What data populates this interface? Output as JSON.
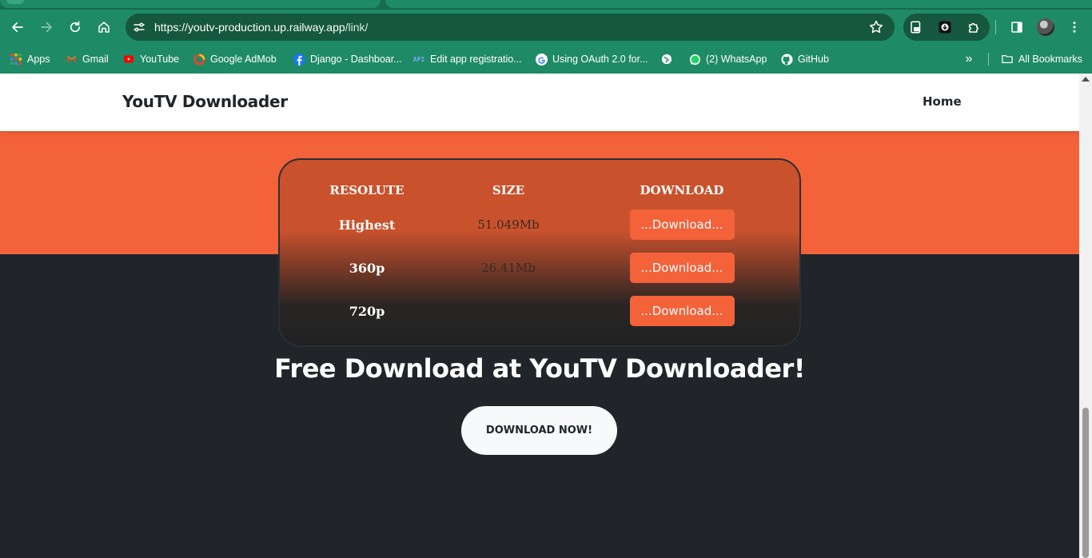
{
  "browser": {
    "url_host": "https://youtv-production.up.railway.app",
    "url_path": "/link/",
    "bookmarks": [
      {
        "label": "Apps",
        "icon": "apps-grid-icon"
      },
      {
        "label": "Gmail",
        "icon": "gmail-icon"
      },
      {
        "label": "YouTube",
        "icon": "youtube-icon"
      },
      {
        "label": "Google AdMob",
        "icon": "admob-icon"
      },
      {
        "label": "Django - Dashboar...",
        "icon": "facebook-icon"
      },
      {
        "label": "Edit app registratio...",
        "icon": "api-icon"
      },
      {
        "label": "Using OAuth 2.0 for...",
        "icon": "google-icon"
      },
      {
        "label": "",
        "icon": "globe-icon"
      },
      {
        "label": "(2) WhatsApp",
        "icon": "whatsapp-icon"
      },
      {
        "label": "GitHub",
        "icon": "github-icon"
      }
    ],
    "all_bookmarks_label": "All Bookmarks"
  },
  "site": {
    "brand": "YouTV Downloader",
    "nav_home": "Home"
  },
  "table": {
    "headers": [
      "RESOLUTE",
      "SIZE",
      "DOWNLOAD"
    ],
    "rows": [
      {
        "resolution": "Highest",
        "size": "51.049Mb",
        "button": "...Download..."
      },
      {
        "resolution": "360p",
        "size": "26.41Mb",
        "button": "...Download..."
      },
      {
        "resolution": "720p",
        "size": "",
        "button": "...Download..."
      }
    ]
  },
  "cta": {
    "title": "Free Download at YouTV Downloader!",
    "button": "DOWNLOAD NOW!"
  },
  "colors": {
    "browser_green": "#1f8a66",
    "accent_orange": "#f4623a",
    "dark_bg": "#212529"
  }
}
